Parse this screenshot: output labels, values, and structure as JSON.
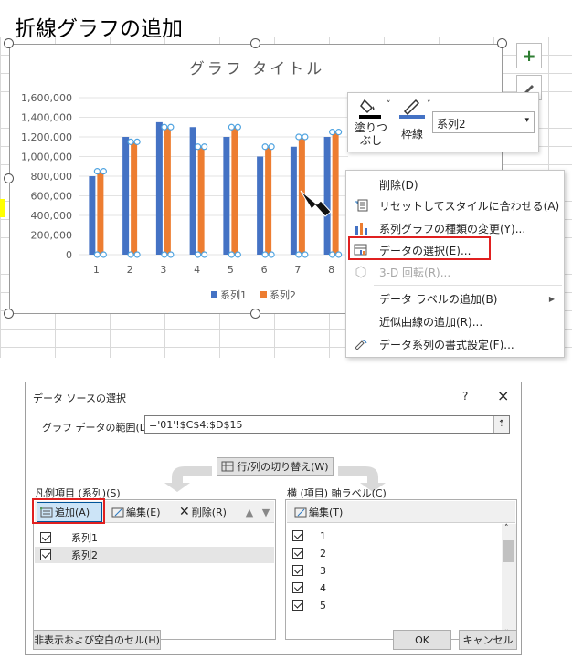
{
  "heading": "折線グラフの追加",
  "chart": {
    "title": "グラフ タイトル",
    "side_buttons": [
      "plus-icon",
      "brush-icon"
    ]
  },
  "chart_data": {
    "type": "bar",
    "title": "グラフ タイトル",
    "categories": [
      "1",
      "2",
      "3",
      "4",
      "5",
      "6",
      "7",
      "8"
    ],
    "series": [
      {
        "name": "系列1",
        "color": "#4472c4",
        "values": [
          800,
          1200,
          1350,
          1300,
          1200,
          1000,
          1100,
          1200
        ]
      },
      {
        "name": "系列2",
        "color": "#ed7d31",
        "values": [
          850,
          1150,
          1300,
          1100,
          1300,
          1100,
          1200,
          1250
        ]
      }
    ],
    "y_ticks": [
      "1,600,000",
      "1,400,000",
      "1,200,000",
      "1,000,000",
      "800,000",
      "600,000",
      "400,000",
      "200,000",
      "0"
    ],
    "ylim": [
      0,
      1600
    ],
    "legend": "bottom",
    "grid": true
  },
  "minibar": {
    "fill_label_1": "塗りつ",
    "fill_label_2": "ぶし",
    "outline_label": "枠線",
    "series_value": "系列2"
  },
  "context_menu": {
    "items": [
      {
        "label": "削除(D)",
        "disabled": false
      },
      {
        "label": "リセットしてスタイルに合わせる(A)",
        "disabled": false
      },
      {
        "label": "系列グラフの種類の変更(Y)...",
        "disabled": false
      },
      {
        "label": "データの選択(E)...",
        "disabled": false
      },
      {
        "label": "3-D 回転(R)...",
        "disabled": true
      },
      {
        "label": "データ ラベルの追加(B)",
        "disabled": false
      },
      {
        "label": "近似曲線の追加(R)...",
        "disabled": false
      },
      {
        "label": "データ系列の書式設定(F)...",
        "disabled": false
      }
    ]
  },
  "dialog": {
    "title": "データ ソースの選択",
    "help": "?",
    "close": "×",
    "range_label": "グラフ データの範囲(D):",
    "range_value": "='01'!$C$4:$D$15",
    "switch_button": "行/列の切り替え(W)",
    "legend_header": "凡例項目 (系列)(S)",
    "add_button": "追加(A)",
    "edit_button": "編集(E)",
    "delete_button": "削除(R)",
    "series": [
      "系列1",
      "系列2"
    ],
    "axis_header": "横 (項目) 軸ラベル(C)",
    "axis_edit_button": "編集(T)",
    "axis_items": [
      "1",
      "2",
      "3",
      "4",
      "5"
    ],
    "hidden_cells_button": "非表示および空白のセル(H)",
    "ok": "OK",
    "cancel": "キャンセル"
  }
}
